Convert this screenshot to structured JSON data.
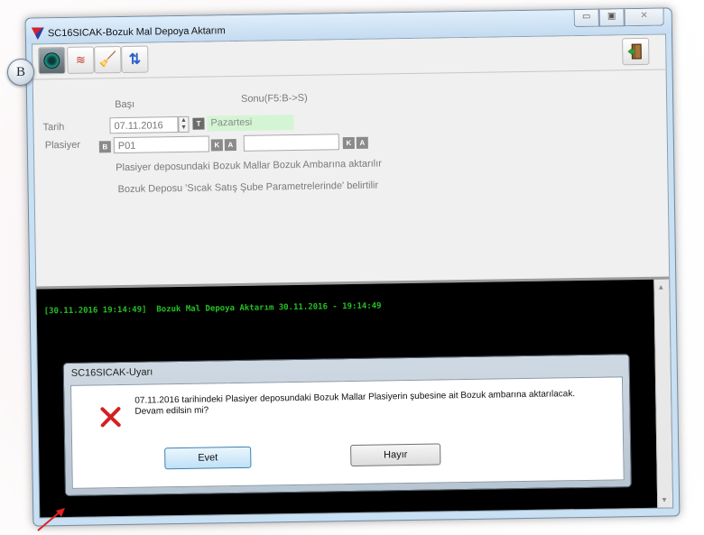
{
  "window": {
    "title": "SC16SICAK-Bozuk Mal Depoya Aktarım",
    "controls": {
      "minimize": "▭",
      "maximize": "▣",
      "close": "✕"
    }
  },
  "toolbar": {
    "buttons": [
      {
        "name": "dial-icon"
      },
      {
        "name": "list-icon",
        "glyph": "≋"
      },
      {
        "name": "brush-icon",
        "glyph": "🧹"
      },
      {
        "name": "transfer-icon",
        "glyph": "⇅"
      }
    ],
    "exit_icon": "exit-door-icon"
  },
  "form": {
    "header_start": "Başı",
    "header_end": "Sonu(F5:B->S)",
    "tarih_label": "Tarih",
    "tarih_value": "07.11.2016",
    "t_button": "T",
    "day_value": "Pazartesi",
    "plasiyer_label": "Plasiyer",
    "b_button": "B",
    "plasiyer_value": "P01",
    "k_button": "K",
    "a_button": "A",
    "plasiyer_end_value": "",
    "note1": "Plasiyer deposundaki Bozuk Mallar Bozuk Ambarına aktarılır",
    "note2": "Bozuk Deposu 'Sıcak Satış Şube Parametrelerinde' belirtilir"
  },
  "console": {
    "line": "[30.11.2016 19:14:49]  Bozuk Mal Depoya Aktarım 30.11.2016 - 19:14:49"
  },
  "dialog": {
    "title": "SC16SICAK-Uyarı",
    "message": "07.11.2016 tarihindeki Plasiyer deposundaki Bozuk Mallar Plasiyerin şubesine ait Bozuk ambarına aktarılacak. Devam edilsin mi?",
    "yes_label": "Evet",
    "no_label": "Hayır"
  },
  "annotation": {
    "badge": "B"
  },
  "colors": {
    "console_text": "#24c024",
    "day_bg": "#d4f5d4",
    "error_icon": "#d42020",
    "arrow": "#e02020"
  }
}
